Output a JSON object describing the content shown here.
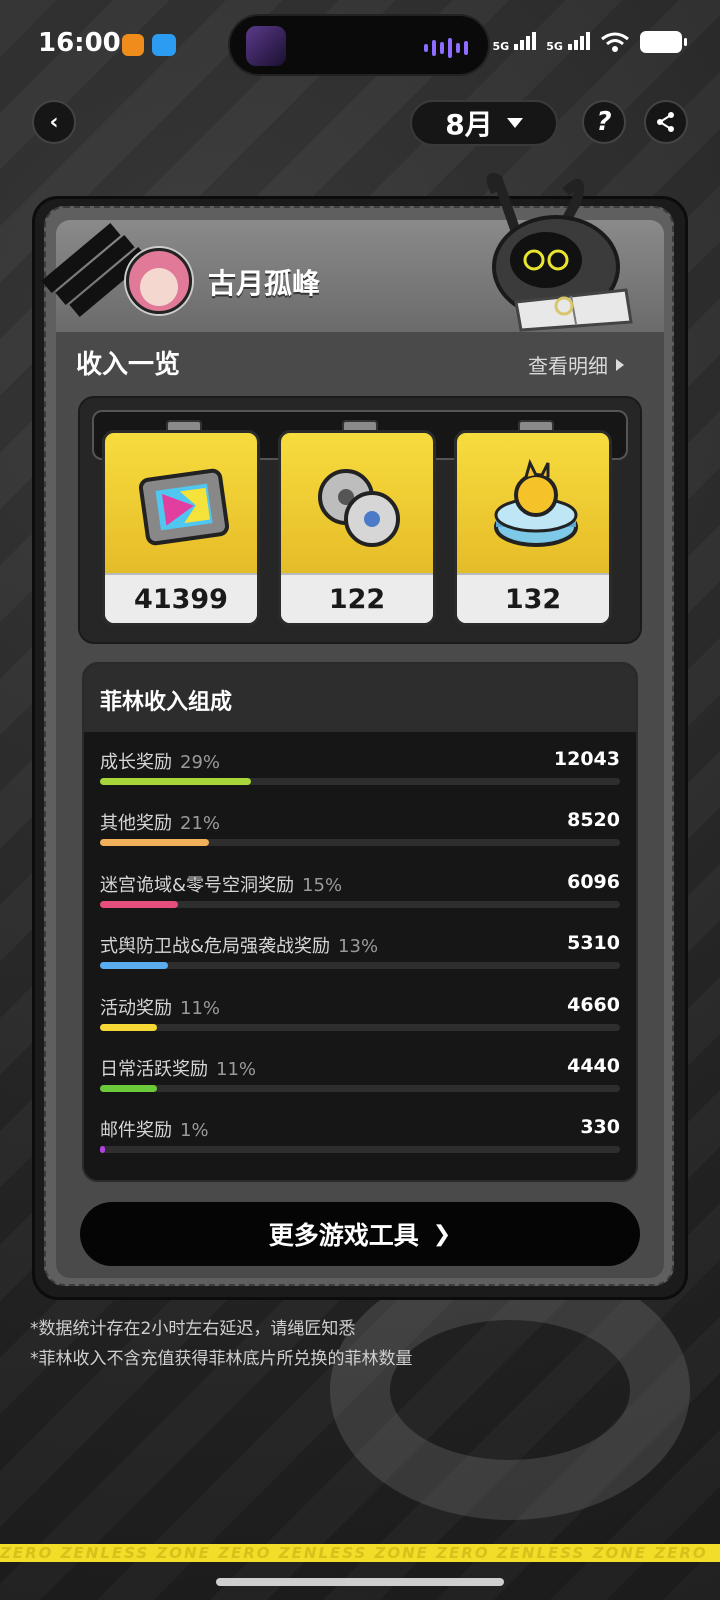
{
  "status_bar": {
    "time": "16:00",
    "signal_1": "5G",
    "signal_2": "5G"
  },
  "header": {
    "month": "8月"
  },
  "profile": {
    "username": "古月孤峰"
  },
  "income_overview": {
    "title": "收入一览",
    "detail_link": "查看明细",
    "rewards": [
      {
        "icon": "film-ticket-icon",
        "value": "41399"
      },
      {
        "icon": "film-reels-icon",
        "value": "122"
      },
      {
        "icon": "bangboo-coin-icon",
        "value": "132"
      }
    ]
  },
  "composition": {
    "title": "菲林收入组成",
    "items": [
      {
        "name": "成长奖励",
        "pct": "29%",
        "value": "12043",
        "fraction": 0.29,
        "color": "#a8d63a"
      },
      {
        "name": "其他奖励",
        "pct": "21%",
        "value": "8520",
        "fraction": 0.21,
        "color": "#f0b15a"
      },
      {
        "name": "迷宫诡域&零号空洞奖励",
        "pct": "15%",
        "value": "6096",
        "fraction": 0.15,
        "color": "#e64e7b"
      },
      {
        "name": "式舆防卫战&危局强袭战奖励",
        "pct": "13%",
        "value": "5310",
        "fraction": 0.13,
        "color": "#5aaef0"
      },
      {
        "name": "活动奖励",
        "pct": "11%",
        "value": "4660",
        "fraction": 0.11,
        "color": "#f5d836"
      },
      {
        "name": "日常活跃奖励",
        "pct": "11%",
        "value": "4440",
        "fraction": 0.11,
        "color": "#6cc93a"
      },
      {
        "name": "邮件奖励",
        "pct": "1%",
        "value": "330",
        "fraction": 0.01,
        "color": "#b044e0"
      }
    ]
  },
  "more_tools_button": "更多游戏工具",
  "footnotes": [
    "*数据统计存在2小时左右延迟，请绳匠知悉",
    "*菲林收入不含充值获得菲林底片所兑换的菲林数量"
  ],
  "brand_strip": "ZERO ZENLESS ZONE ZERO ZENLESS ZONE ZERO ZENLESS ZONE ZERO"
}
